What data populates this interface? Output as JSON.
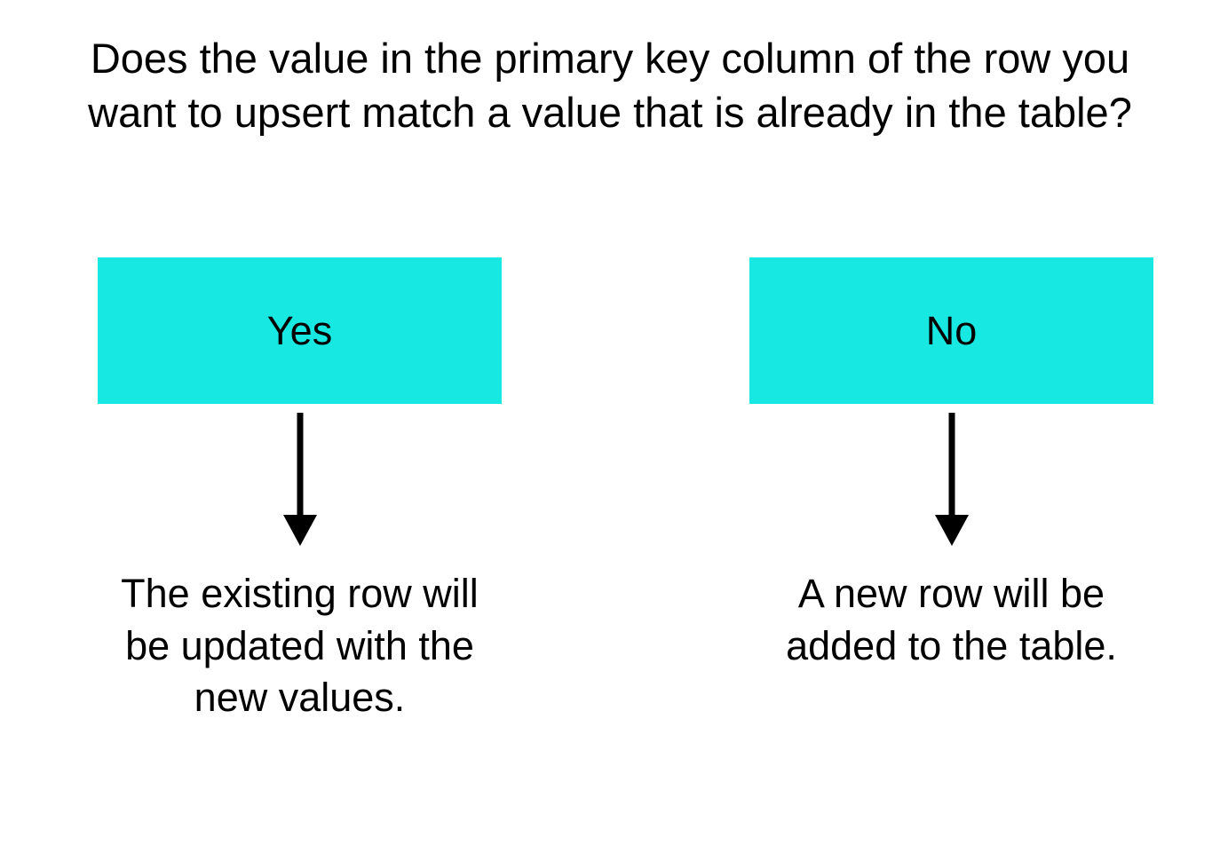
{
  "question": "Does the value in the primary key column of the row you want to upsert match a value that is already in the table?",
  "branches": {
    "yes": {
      "label": "Yes",
      "result": "The existing row will be updated with the new values."
    },
    "no": {
      "label": "No",
      "result": "A new row will be added to the table."
    }
  },
  "colors": {
    "choice_box": "#17e8e1",
    "text": "#000000",
    "background": "#ffffff"
  }
}
